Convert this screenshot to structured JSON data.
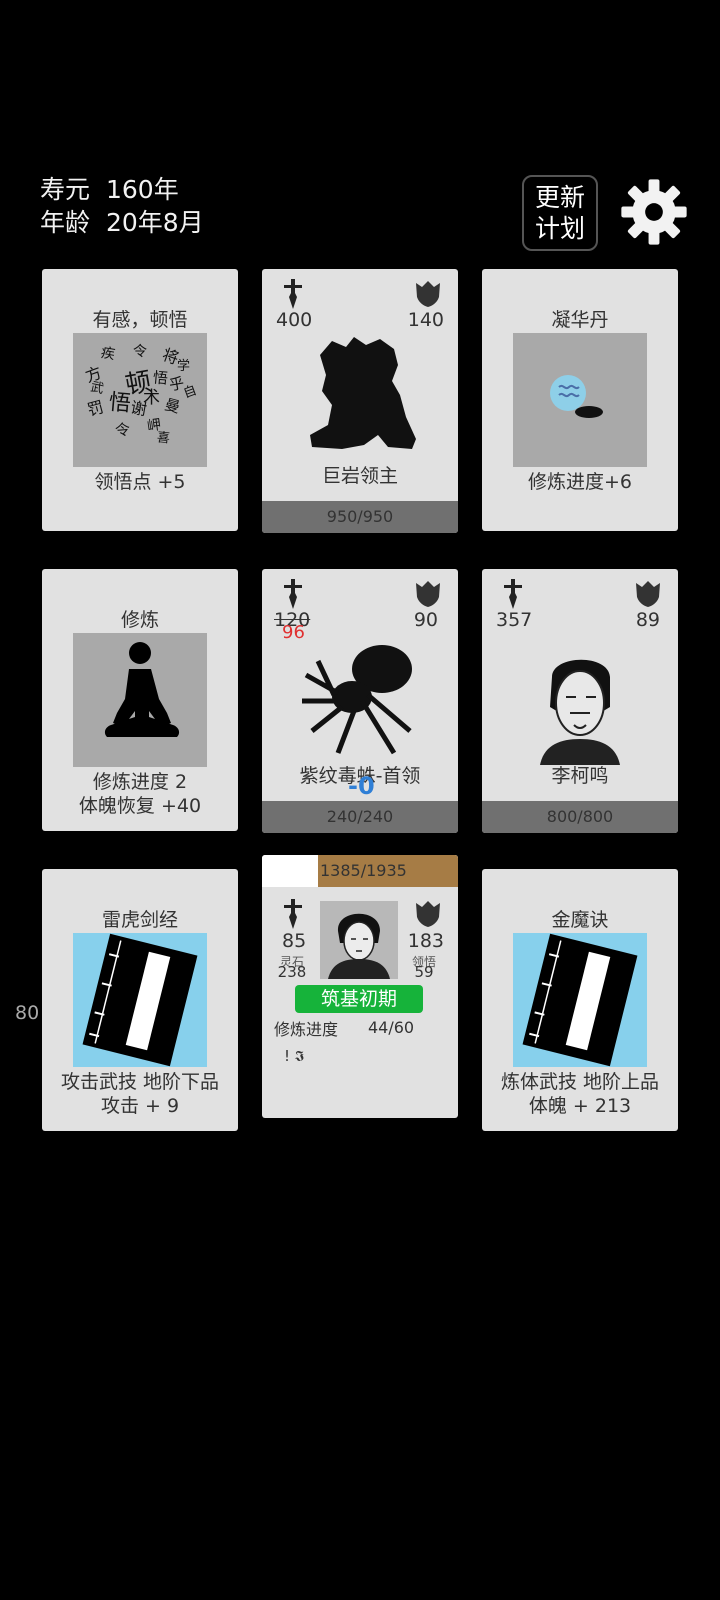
{
  "hud": {
    "lifespan_label": "寿元",
    "lifespan_value": "160年",
    "age_label": "年龄",
    "age_value": "20年8月",
    "update_plan_label": "更新\n计划",
    "settings_icon": "gear-icon"
  },
  "side_number": "80",
  "cards": {
    "insight": {
      "title": "有感，顿悟",
      "desc": "领悟点  +5",
      "glyphs": [
        "顿",
        "悟",
        "方",
        "疾",
        "令",
        "将",
        "乎",
        "悟",
        "罚",
        "谢",
        "术",
        "令",
        "曼",
        "学",
        "岬",
        "武",
        "自",
        "喜"
      ]
    },
    "boss1": {
      "attack": "400",
      "defense": "140",
      "name": "巨岩领主",
      "hp": "950/950"
    },
    "pill": {
      "title": "凝华丹",
      "desc": "修炼进度+6"
    },
    "cultivate": {
      "title": "修炼",
      "desc1": "修炼进度  2",
      "desc2": "体魄恢复  +40"
    },
    "boss2": {
      "attack": "120",
      "attack_new": "96",
      "defense": "90",
      "name": "紫纹毒蛛-首领",
      "hp": "240/240",
      "damage_float": "-0"
    },
    "npc": {
      "attack": "357",
      "defense": "89",
      "name": "李柯鸣",
      "hp": "800/800"
    },
    "skill1": {
      "title": "雷虎剑经",
      "desc1": "攻击武技  地阶下品",
      "desc2": "攻击 + 9"
    },
    "player": {
      "exp": "1385/1935",
      "exp_fraction": 0.716,
      "attack": "85",
      "defense": "183",
      "spirit_stone_label": "灵石",
      "spirit_stone": "238",
      "insight_label": "领悟",
      "insight": "59",
      "realm": "筑基初期",
      "progress_label": "修炼进度",
      "progress_value": "44/60",
      "status_glyphs": "! 𝕴"
    },
    "skill2": {
      "title": "金魔诀",
      "desc1": "炼体武技  地阶上品",
      "desc2": "体魄 + 213"
    }
  },
  "colors": {
    "card_bg": "#e1e1e1",
    "realm_green": "#16b33a",
    "exp_brown": "#a67c45",
    "damage_red": "#e03030",
    "float_blue": "#2f7fd6"
  }
}
